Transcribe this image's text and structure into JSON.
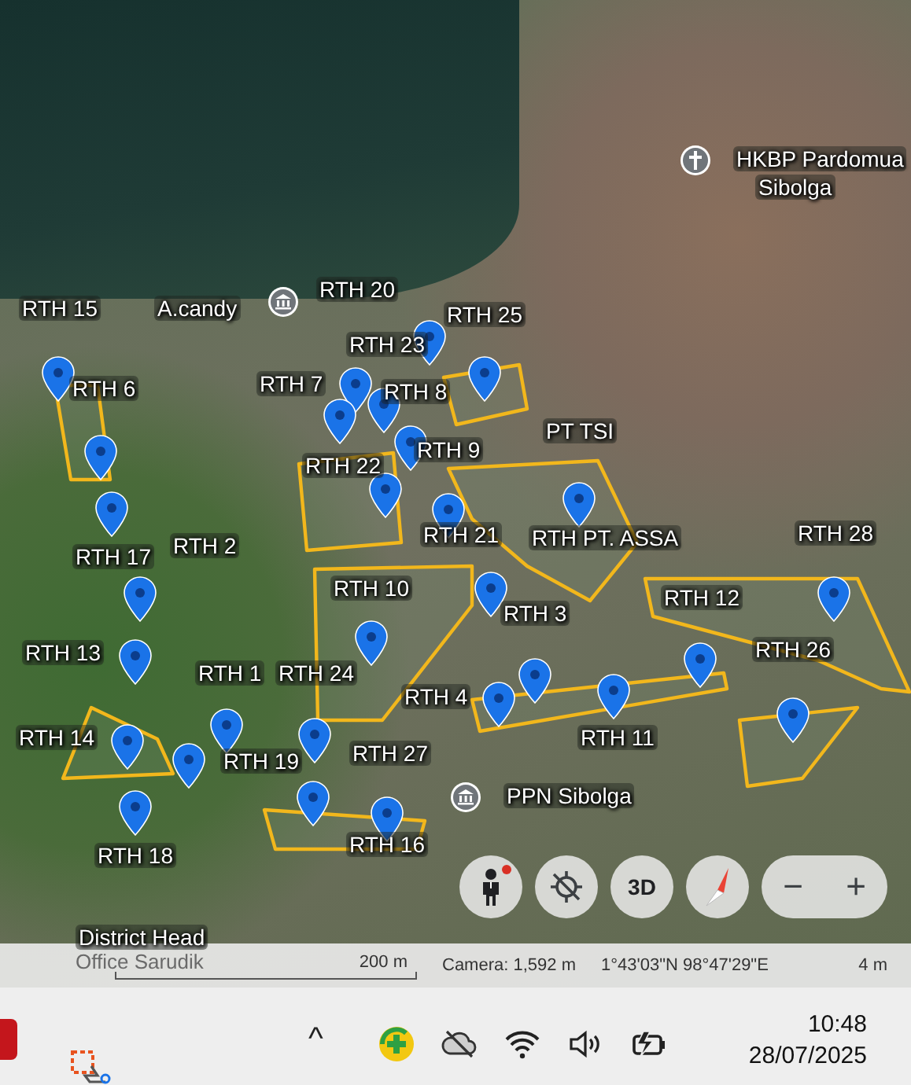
{
  "map": {
    "places": [
      {
        "kind": "church",
        "text": "HKBP Pardomua"
      },
      {
        "kind": "label",
        "text": "Sibolga"
      },
      {
        "kind": "label",
        "text": "RTH 15"
      },
      {
        "kind": "poi",
        "text": "A.candy"
      },
      {
        "kind": "label",
        "text": "RTH 20"
      },
      {
        "kind": "label",
        "text": "RTH 25"
      },
      {
        "kind": "label",
        "text": "RTH 23"
      },
      {
        "kind": "label",
        "text": "RTH 6"
      },
      {
        "kind": "label",
        "text": "RTH 7"
      },
      {
        "kind": "label",
        "text": "RTH 8"
      },
      {
        "kind": "label",
        "text": "PT TSI"
      },
      {
        "kind": "label",
        "text": "RTH 9"
      },
      {
        "kind": "label",
        "text": "RTH 22"
      },
      {
        "kind": "label",
        "text": "RTH 21"
      },
      {
        "kind": "label",
        "text": "RTH PT. ASSA"
      },
      {
        "kind": "label",
        "text": "RTH 28"
      },
      {
        "kind": "label",
        "text": "RTH 17"
      },
      {
        "kind": "label",
        "text": "RTH 2"
      },
      {
        "kind": "label",
        "text": "RTH 10"
      },
      {
        "kind": "label",
        "text": "RTH 12"
      },
      {
        "kind": "label",
        "text": "RTH 3"
      },
      {
        "kind": "label",
        "text": "RTH 13"
      },
      {
        "kind": "label",
        "text": "RTH 26"
      },
      {
        "kind": "label",
        "text": "RTH 1"
      },
      {
        "kind": "label",
        "text": "RTH 24"
      },
      {
        "kind": "label",
        "text": "RTH 4"
      },
      {
        "kind": "label",
        "text": "RTH 14"
      },
      {
        "kind": "label",
        "text": "RTH 11"
      },
      {
        "kind": "label",
        "text": "RTH 19"
      },
      {
        "kind": "label",
        "text": "RTH 27"
      },
      {
        "kind": "poi",
        "text": "PPN Sibolga"
      },
      {
        "kind": "label",
        "text": "RTH 18"
      },
      {
        "kind": "label",
        "text": "RTH 16"
      },
      {
        "kind": "label",
        "text": "District Head"
      },
      {
        "kind": "label",
        "text": "Office Sarudik"
      }
    ]
  },
  "controls": [
    {
      "kind": "pegman",
      "alert": true
    },
    {
      "kind": "locate"
    },
    {
      "kind": "view",
      "label": "3D"
    },
    {
      "kind": "compass"
    },
    {
      "kind": "zoom",
      "minus": "−",
      "plus": "+"
    }
  ],
  "status_bar": {
    "scale": "200 m",
    "camera": "Camera: 1,592 m",
    "coordinates": "1°43'03\"N 98°47'29\"E",
    "altitude": "4 m"
  },
  "taskbar": {
    "chevron": "^",
    "time": "10:48",
    "date": "28/07/2025"
  }
}
